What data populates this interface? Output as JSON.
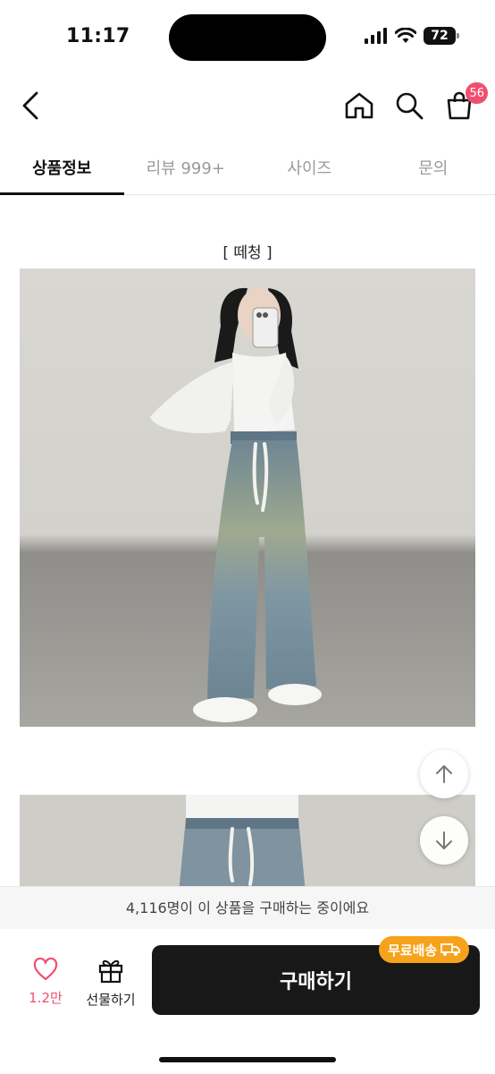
{
  "status_bar": {
    "time": "11:17",
    "battery": "72"
  },
  "header": {
    "cart_badge": "56"
  },
  "tabs": [
    {
      "label": "상품정보",
      "active": true
    },
    {
      "label": "리뷰 999+",
      "active": false
    },
    {
      "label": "사이즈",
      "active": false
    },
    {
      "label": "문의",
      "active": false
    }
  ],
  "content": {
    "caption": "[ 떼청 ]"
  },
  "notice": "4,116명이 이 상품을 구매하는 중이에요",
  "bottom": {
    "like_count": "1.2만",
    "gift_label": "선물하기",
    "buy_label": "구매하기",
    "free_shipping": "무료배송"
  },
  "colors": {
    "accent": "#f0506e",
    "badge": "#f7a21b",
    "buy_button": "#181818"
  }
}
